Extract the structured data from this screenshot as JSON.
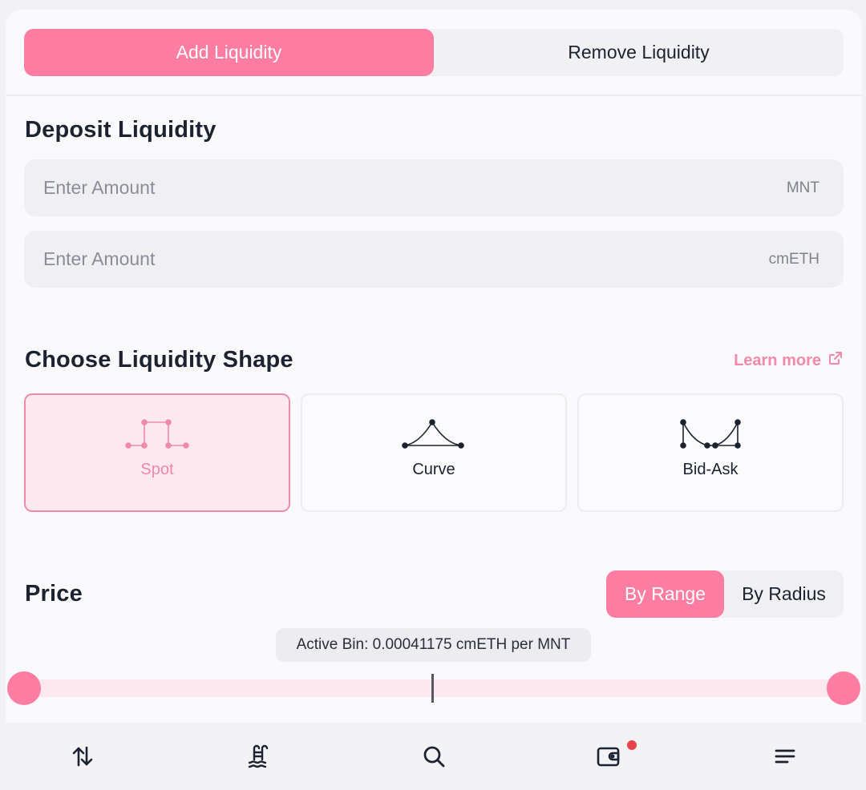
{
  "tabs": {
    "add": "Add Liquidity",
    "remove": "Remove Liquidity"
  },
  "deposit": {
    "title": "Deposit Liquidity",
    "fields": [
      {
        "placeholder": "Enter Amount",
        "unit": "MNT"
      },
      {
        "placeholder": "Enter Amount",
        "unit": "cmETH"
      }
    ]
  },
  "shape": {
    "title": "Choose Liquidity Shape",
    "learn_more": "Learn more",
    "options": [
      "Spot",
      "Curve",
      "Bid-Ask"
    ],
    "selected": "Spot"
  },
  "price": {
    "title": "Price",
    "modes": [
      "By Range",
      "By Radius"
    ],
    "selected_mode": "By Range",
    "active_bin": "Active Bin: 0.00041175 cmETH per MNT"
  },
  "colors": {
    "accent": "#ff7ca3",
    "accent_light": "#fce8ee",
    "notification": "#e8434b"
  },
  "bottom_nav": [
    "swap-icon",
    "pool-icon",
    "search-icon",
    "wallet-icon",
    "menu-icon"
  ]
}
